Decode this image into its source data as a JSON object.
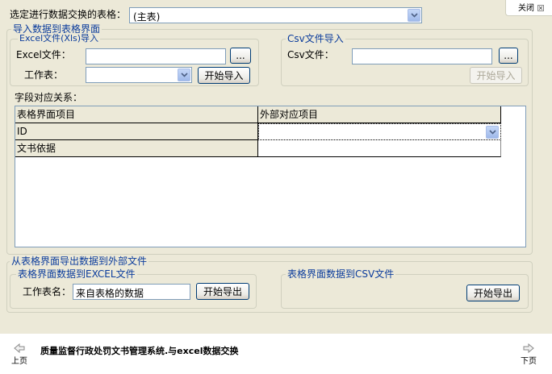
{
  "window": {
    "close_label": "关闭",
    "close_icon": "close-icon"
  },
  "top": {
    "select_table_label": "选定进行数据交换的表格：",
    "selected_table": "(主表)"
  },
  "import_section": {
    "title": "导入数据到表格界面",
    "excel": {
      "title": "Excel文件(Xls)导入",
      "file_label": "Excel文件：",
      "file_value": "",
      "browse_label": "...",
      "sheet_label": "工作表：",
      "sheet_value": "",
      "import_button": "开始导入"
    },
    "csv": {
      "title": "Csv文件导入",
      "file_label": "Csv文件：",
      "file_value": "",
      "browse_label": "...",
      "import_button": "开始导入"
    }
  },
  "mapping": {
    "title": "字段对应关系：",
    "columns": [
      "表格界面项目",
      "外部对应项目"
    ],
    "rows": [
      {
        "item": "ID",
        "external": ""
      },
      {
        "item": "文书依据",
        "external": ""
      }
    ]
  },
  "export_section": {
    "title": "从表格界面导出数据到外部文件",
    "excel": {
      "title": "表格界面数据到EXCEL文件",
      "sheet_label": "工作表名：",
      "sheet_value": "来自表格的数据",
      "export_button": "开始导出"
    },
    "csv": {
      "title": "表格界面数据到CSV文件",
      "export_button": "开始导出"
    }
  },
  "footer": {
    "prev_label": "上页",
    "next_label": "下页",
    "caption": "质量监督行政处罚文书管理系统.与excel数据交换"
  }
}
